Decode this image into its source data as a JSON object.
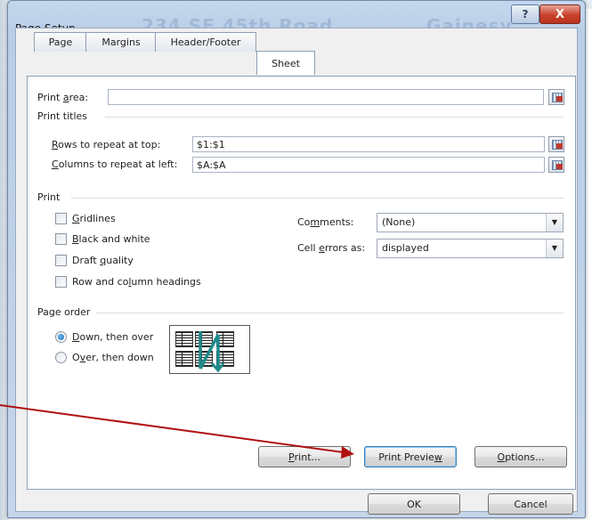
{
  "window": {
    "title": "Page Setup",
    "background_title_left": "234 SE 45th Road",
    "background_title_right": "Gainesv",
    "help_glyph": "?",
    "close_glyph": "X"
  },
  "tabs": [
    {
      "label": "Page",
      "active": false
    },
    {
      "label": "Margins",
      "active": false
    },
    {
      "label": "Header/Footer",
      "active": false
    },
    {
      "label": "Sheet",
      "active": true
    }
  ],
  "print_area": {
    "label_pre": "Print ",
    "label_key": "a",
    "label_post": "rea:",
    "value": ""
  },
  "print_titles": {
    "heading": "Print titles",
    "rows": {
      "label_key": "R",
      "label_post": "ows to repeat at top:",
      "value": "$1:$1"
    },
    "columns": {
      "label_key": "C",
      "label_post": "olumns to repeat at left:",
      "value": "$A:$A"
    }
  },
  "print": {
    "heading": "Print",
    "gridlines": {
      "key": "G",
      "rest": "ridlines",
      "checked": false
    },
    "black_white": {
      "key": "B",
      "rest": "lack and white",
      "checked": false
    },
    "draft": {
      "pre": "Draft ",
      "key": "q",
      "rest": "uality",
      "checked": false
    },
    "headings": {
      "pre": "Row and co",
      "key": "l",
      "rest": "umn headings",
      "checked": false
    },
    "comments": {
      "pre": "Co",
      "key": "m",
      "rest": "ments:",
      "value": "(None)"
    },
    "cell_errors": {
      "pre": "Cell ",
      "key": "e",
      "rest": "rrors as:",
      "value": "displayed"
    }
  },
  "page_order": {
    "heading": "Page order",
    "down_over": {
      "key": "D",
      "rest": "own, then over",
      "selected": true
    },
    "over_down": {
      "pre": "O",
      "key": "v",
      "rest": "er, then down",
      "selected": false
    }
  },
  "buttons": {
    "print": {
      "key": "P",
      "rest": "rint..."
    },
    "print_preview": {
      "pre": "Print Previe",
      "key": "w",
      "rest": ""
    },
    "options": {
      "key": "O",
      "rest": "ptions..."
    },
    "ok": "OK",
    "cancel": "Cancel"
  },
  "colors": {
    "annotation_arrow": "#b01010",
    "page_order_arrow": "#1f8a8a"
  }
}
